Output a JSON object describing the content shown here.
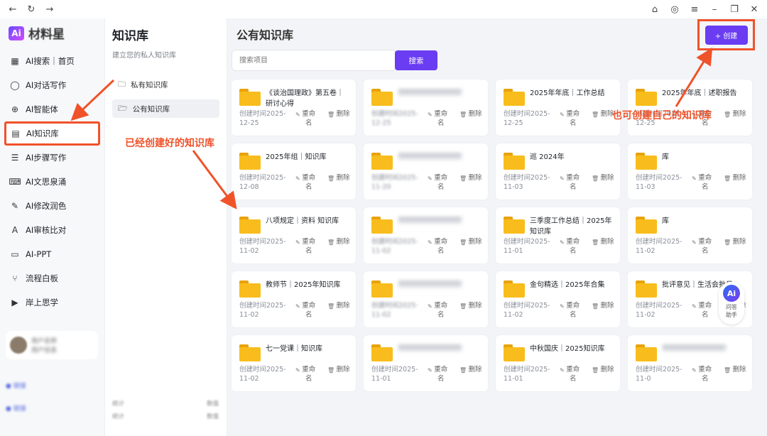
{
  "window": {
    "icons": [
      "back-arrow-icon",
      "refresh-icon",
      "forward-arrow-icon"
    ],
    "right_icons": [
      "home-icon",
      "pin-icon",
      "menu-icon",
      "minimize-icon",
      "restore-icon",
      "close-icon"
    ]
  },
  "sidebar": {
    "logo_badge": "Ai",
    "logo_text": "材料星",
    "items": [
      {
        "label": "AI搜索｜首页",
        "icon": "grid-icon"
      },
      {
        "label": "AI对话写作",
        "icon": "chat-icon"
      },
      {
        "label": "AI智能体",
        "icon": "agent-icon"
      },
      {
        "label": "AI知识库",
        "icon": "book-icon"
      },
      {
        "label": "AI步骤写作",
        "icon": "list-icon"
      },
      {
        "label": "AI文思泉涌",
        "icon": "keyboard-icon"
      },
      {
        "label": "AI修改润色",
        "icon": "pen-icon"
      },
      {
        "label": "AI审核比对",
        "icon": "compare-icon"
      },
      {
        "label": "AI-PPT",
        "icon": "presentation-icon"
      },
      {
        "label": "流程白板",
        "icon": "flow-icon"
      },
      {
        "label": "岸上思学",
        "icon": "play-icon"
      }
    ]
  },
  "kb_panel": {
    "title": "知识库",
    "subtitle": "建立您的私人知识库",
    "tabs": [
      "私有知识库",
      "公有知识库"
    ]
  },
  "main": {
    "title": "公有知识库",
    "create_label": "+ 创建",
    "search_placeholder": "搜索项目",
    "search_button": "搜索",
    "rename_label": "重命名",
    "delete_label": "删除",
    "cards": [
      {
        "title": "《谈治国理政》第五卷｜研讨心得",
        "date": "创建时间2025-12-25",
        "blur_title": false,
        "blur_date": false
      },
      {
        "title": "",
        "date": "创建时间2025-12-25",
        "blur_title": true,
        "blur_date": true
      },
      {
        "title": "2025年年底｜工作总结",
        "date": "创建时间2025-12-25",
        "blur_title": false,
        "blur_date": false
      },
      {
        "title": "2025年年底｜述职报告",
        "date": "创建时间2025-12-25",
        "blur_title": false,
        "blur_date": false
      },
      {
        "title": "2025年组｜知识库",
        "date": "创建时间2025-12-08",
        "blur_title": false,
        "blur_date": false
      },
      {
        "title": "",
        "date": "创建时间2025-11-20",
        "blur_title": true,
        "blur_date": true
      },
      {
        "title": "巡 2024年",
        "date": "创建时间2025-11-03",
        "blur_title": false,
        "blur_date": false
      },
      {
        "title": "库",
        "date": "创建时间2025-11-03",
        "blur_title": false,
        "blur_date": false
      },
      {
        "title": "八项规定｜资料 知识库",
        "date": "创建时间2025-11-02",
        "blur_title": false,
        "blur_date": false
      },
      {
        "title": "",
        "date": "创建时间2025-11-02",
        "blur_title": true,
        "blur_date": true
      },
      {
        "title": "三季度工作总结｜2025年知识库",
        "date": "创建时间2025-11-01",
        "blur_title": false,
        "blur_date": false
      },
      {
        "title": "库",
        "date": "创建时间2025-11-02",
        "blur_title": false,
        "blur_date": false
      },
      {
        "title": "教师节｜2025年知识库",
        "date": "创建时间2025-11-02",
        "blur_title": false,
        "blur_date": false
      },
      {
        "title": "",
        "date": "创建时间2025-11-02",
        "blur_title": true,
        "blur_date": true
      },
      {
        "title": "金句精选｜2025年合集",
        "date": "创建时间2025-11-02",
        "blur_title": false,
        "blur_date": false
      },
      {
        "title": "批评意见｜生活会批见",
        "date": "创建时间2025-11-02",
        "blur_title": false,
        "blur_date": false
      },
      {
        "title": "七一党课｜知识库",
        "date": "创建时间2025-11-02",
        "blur_title": false,
        "blur_date": false
      },
      {
        "title": "",
        "date": "创建时间2025-11-01",
        "blur_title": true,
        "blur_date": false
      },
      {
        "title": "中秋国庆｜2025知识库",
        "date": "创建时间2025-11-01",
        "blur_title": false,
        "blur_date": false
      },
      {
        "title": "",
        "date": "创建时间2025-11-0",
        "blur_title": true,
        "blur_date": false
      }
    ],
    "helper_badge": "Ai",
    "helper_label": "问答助手"
  },
  "annotations": {
    "created": "已经创建好的知识库",
    "can_create": "也可创建自己的知识库"
  },
  "colors": {
    "accent": "#6a3cf2",
    "annotation": "#f0522a",
    "folder": "#f8bd1c"
  }
}
